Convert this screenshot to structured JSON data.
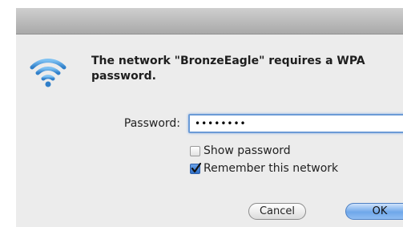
{
  "dialog": {
    "message": "The network \"BronzeEagle\" requires a WPA password.",
    "icon": "wifi-icon"
  },
  "password": {
    "label": "Password:",
    "value": "••••••••"
  },
  "options": {
    "show_password": {
      "label": "Show password",
      "checked": false
    },
    "remember_network": {
      "label": "Remember this network",
      "checked": true
    }
  },
  "buttons": {
    "cancel": "Cancel",
    "ok": "OK"
  },
  "colors": {
    "accent": "#2f6fc7",
    "wifi_icon": "#3f8ed6"
  }
}
